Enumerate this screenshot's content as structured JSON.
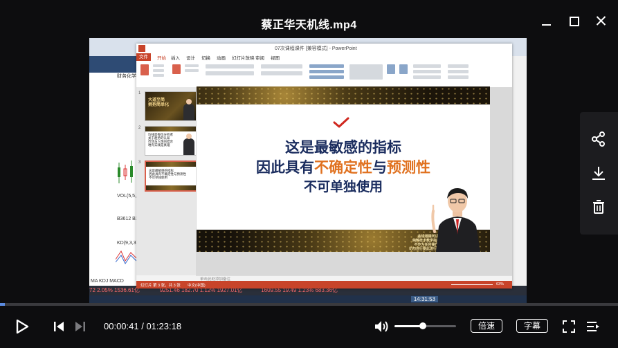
{
  "window": {
    "title": "蔡正华天机线.mp4"
  },
  "video": {
    "background_app": {
      "status_ticker": [
        "72  2.05%  1536.61亿",
        "9251.46  182.70  1.12%  1927.01亿",
        "1609.55  19.49  1.23%  683.36亿"
      ],
      "clock": "14:31:53",
      "side_labels": [
        "财务化学 1",
        "VOL(5,5,20)",
        "B3612  B36",
        "KD(9,3,3)",
        "MA KDJ MACD"
      ]
    },
    "ppt": {
      "window_title": "07次课程课件 [兼容模式] - PowerPoint",
      "tabs": [
        "文件",
        "开始",
        "插入",
        "设计",
        "切换",
        "动画",
        "幻灯片放映",
        "审阅",
        "视图"
      ],
      "slide_numbers": [
        "1",
        "2",
        "3"
      ],
      "thumbs": [
        {
          "text": "大道至简\n拥抱简单化"
        },
        {
          "text": "均线是每位分析者\n关于趋势的认知\n市场与人性的结合\n唯有实践是真理"
        },
        {
          "text": "这是最敏感的指标\n因此具有不确定性与预测性\n不可单独使用"
        }
      ],
      "slide": {
        "line1": "这是最敏感的指标",
        "line2_a": "因此具有",
        "line2_b": "不确定性",
        "line2_c": "与",
        "line2_d": "预测性",
        "line3": "不可单独使用",
        "caption": "金钱道顾问讨论\n纯粹技术教学指导研讨\n不作为任何操作依据\n切勿自行据此进行投资介入"
      },
      "notes_placeholder": "单击此处添加备注",
      "status": {
        "left": "幻灯片 第 3 张，共 3 张",
        "lang": "中文(中国)",
        "zoom": "63%"
      }
    }
  },
  "side_panel": {
    "icons": [
      "share-icon",
      "download-icon",
      "trash-icon"
    ]
  },
  "player": {
    "progress_fraction": 0.0082,
    "current_time": "00:00:41",
    "duration": "01:23:18",
    "time_separator": " / ",
    "volume_fraction": 0.46,
    "speed_label": "倍速",
    "subtitle_label": "字幕"
  }
}
